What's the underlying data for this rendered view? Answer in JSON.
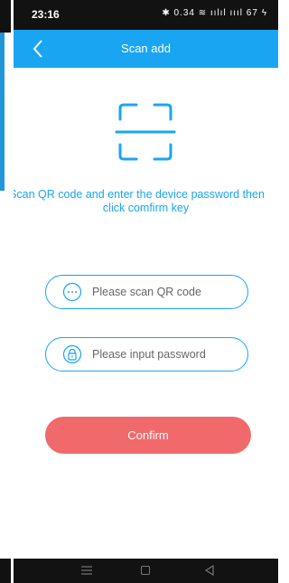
{
  "status_bar": {
    "time": "23:16",
    "icons_text": "✱ 0.34 ≋ ıılıl ıııl 67 ϟ"
  },
  "header": {
    "title": "Scan add",
    "back_icon": "chevron-left-icon"
  },
  "scan_icon": "qr-scan-icon",
  "instruction": {
    "line1": "Scan QR code and enter the device password then",
    "line2": "click comfirm key"
  },
  "qr_field": {
    "placeholder": "Please scan QR code",
    "icon": "dots-circle-icon"
  },
  "password_field": {
    "placeholder": "Please input password",
    "icon": "lock-icon"
  },
  "confirm_button": {
    "label": "Confirm"
  },
  "colors": {
    "primary": "#1aa5f2",
    "confirm": "#f06a6b",
    "status_bar": "#121212"
  }
}
